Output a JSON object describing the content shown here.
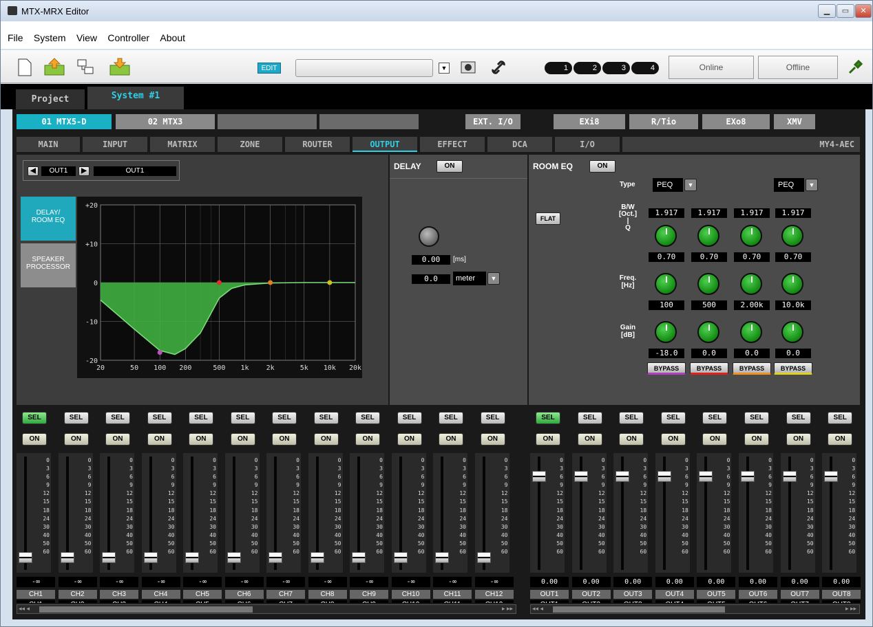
{
  "window": {
    "title": "MTX-MRX Editor",
    "min": "▁",
    "max": "▭",
    "close": "✕"
  },
  "menu": [
    "File",
    "System",
    "View",
    "Controller",
    "About"
  ],
  "toolbar": {
    "edit_label": "EDIT",
    "unit_ids": [
      "1",
      "2",
      "3",
      "4"
    ],
    "online_label": "Online",
    "offline_label": "Offline"
  },
  "project_tabs": {
    "project": "Project",
    "system": "System #1"
  },
  "device_tabs": [
    "01 MTX5-D",
    "02 MTX3",
    "",
    "",
    "EXT. I/O",
    "EXi8",
    "R/Tio",
    "EXo8",
    "XMV"
  ],
  "sub_tabs": [
    "MAIN",
    "INPUT",
    "MATRIX",
    "ZONE",
    "ROUTER",
    "OUTPUT",
    "EFFECT",
    "DCA",
    "I/O",
    "MY4-AEC"
  ],
  "out_selector": {
    "channel": "OUT1",
    "name": "OUT1"
  },
  "side_buttons": {
    "delay_room_eq": "DELAY/\nROOM EQ",
    "speaker_processor": "SPEAKER\nPROCESSOR"
  },
  "chart_data": {
    "type": "line",
    "x_ticks": [
      "20",
      "50",
      "100",
      "200",
      "500",
      "1k",
      "2k",
      "5k",
      "10k",
      "20k"
    ],
    "y_ticks": [
      "+20",
      "+10",
      "0",
      "-10",
      "-20"
    ],
    "xlim": [
      20,
      20000
    ],
    "ylim": [
      -20,
      20
    ],
    "x_scale": "log",
    "grid": true,
    "series": [
      {
        "x": [
          20,
          50,
          100,
          150,
          200,
          300,
          500,
          700,
          1000,
          2000,
          5000,
          10000,
          20000
        ],
        "y": [
          -4.5,
          -12,
          -17.5,
          -18.5,
          -17,
          -13,
          -4,
          -1.5,
          -0.6,
          -0.1,
          0,
          0,
          0
        ]
      }
    ],
    "band_points": [
      {
        "x": 100,
        "y": -18,
        "color": "#c050c0"
      },
      {
        "x": 500,
        "y": 0,
        "color": "#e03030"
      },
      {
        "x": 2000,
        "y": 0,
        "color": "#e08020"
      },
      {
        "x": 10000,
        "y": 0,
        "color": "#d0c020"
      }
    ]
  },
  "delay": {
    "title": "DELAY",
    "on": "ON",
    "ms_value": "0.00",
    "ms_unit": "[ms]",
    "dist_value": "0.0",
    "dist_unit": "meter"
  },
  "room_eq": {
    "title": "ROOM EQ",
    "on": "ON",
    "flat": "FLAT",
    "type_label": "Type",
    "type_values": [
      "PEQ",
      "PEQ"
    ],
    "bw_label": "B/W\n[Oct.]\n|\nQ",
    "bw_values": [
      "1.917",
      "1.917",
      "1.917",
      "1.917"
    ],
    "q_values": [
      "0.70",
      "0.70",
      "0.70",
      "0.70"
    ],
    "freq_label": "Freq.\n[Hz]",
    "freq_values": [
      "100",
      "500",
      "2.00k",
      "10.0k"
    ],
    "gain_label": "Gain\n[dB]",
    "gain_values": [
      "-18.0",
      "0.0",
      "0.0",
      "0.0"
    ],
    "bypass": "BYPASS",
    "band_colors": [
      "#b040c0",
      "#e02020",
      "#f09020",
      "#e0d020"
    ]
  },
  "scale_marks": [
    "0",
    "3",
    "6",
    "9",
    "12",
    "15",
    "18",
    "24",
    "30",
    "40",
    "50",
    "60"
  ],
  "input_strips": {
    "names": [
      "CH1",
      "CH2",
      "CH3",
      "CH4",
      "CH5",
      "CH6",
      "CH7",
      "CH8",
      "CH9",
      "CH10",
      "CH11",
      "CH12"
    ],
    "value": "-∞",
    "sel": "SEL",
    "on": "ON"
  },
  "output_strips": {
    "names": [
      "OUT1",
      "OUT2",
      "OUT3",
      "OUT4",
      "OUT5",
      "OUT6",
      "OUT7",
      "OUT8"
    ],
    "value": "0.00",
    "sel": "SEL",
    "on": "ON"
  },
  "scroll": {
    "left": "◂◂ ◂",
    "right": "▸ ▸▸"
  }
}
